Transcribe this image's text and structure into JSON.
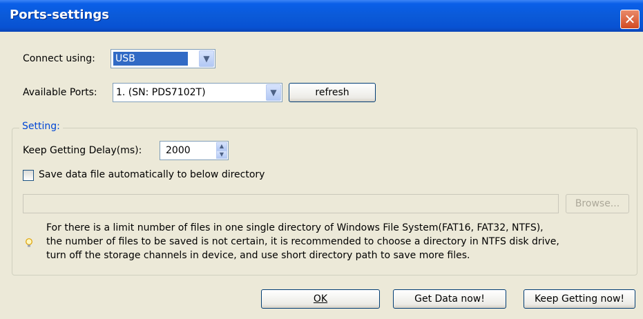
{
  "window": {
    "title": "Ports-settings",
    "close_label": "✕"
  },
  "connect": {
    "label": "Connect using:",
    "value": "USB"
  },
  "ports": {
    "label": "Available Ports:",
    "value": "1. (SN: PDS7102T)",
    "refresh_label": "refresh"
  },
  "setting": {
    "group_title": "Setting:",
    "delay_label": "Keep Getting Delay(ms):",
    "delay_value": "2000",
    "save_label": "Save data file automatically to below directory",
    "save_checked": false,
    "directory_value": "",
    "browse_label": "Browse...",
    "note_lines": [
      "For there is a limit number of files in one single directory of Windows File System(FAT16, FAT32, NTFS),",
      "the number of  files to be saved is not certain,  it is recommended to choose a directory in NTFS disk drive,",
      "turn off the storage channels in device, and use short directory path to save more files."
    ]
  },
  "buttons": {
    "ok": "OK",
    "get_data": "Get Data now!",
    "keep_getting": "Keep Getting now!"
  },
  "colors": {
    "title_bar": "#0a5ee8",
    "close": "#d24a22",
    "group_title": "#0046d5",
    "selection": "#316ac5"
  },
  "icons": {
    "close": "close-icon",
    "dropdown": "chevron-down-icon",
    "hint": "lightbulb-icon"
  }
}
